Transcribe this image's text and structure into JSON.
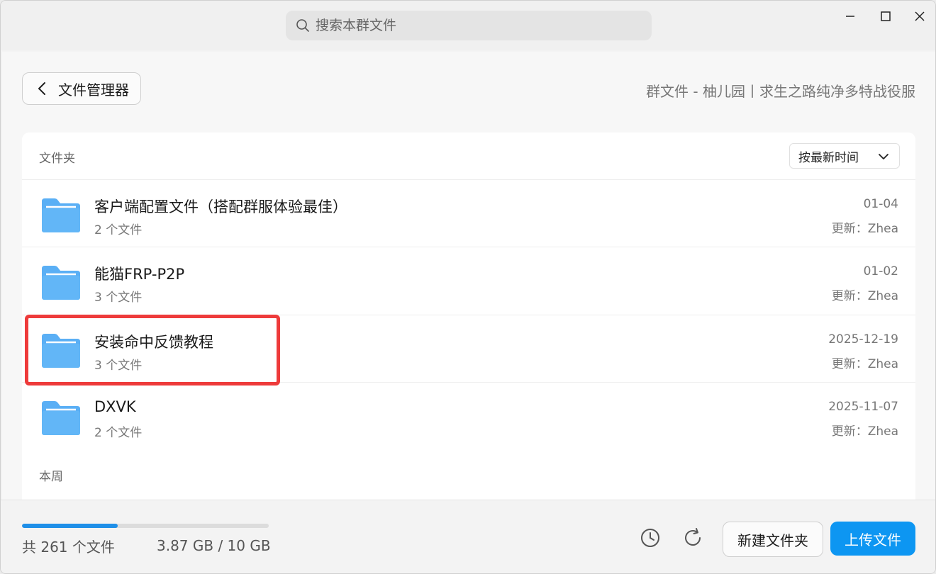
{
  "search": {
    "placeholder": "搜索本群文件"
  },
  "header": {
    "back_label": "文件管理器",
    "group_title": "群文件 - 柚儿园丨求生之路纯净多特战役服"
  },
  "folders_section": {
    "label": "文件夹",
    "sort_label": "按最新时间"
  },
  "folders": [
    {
      "name": "客户端配置文件（搭配群服体验最佳）",
      "count": "2 个文件",
      "date": "01-04",
      "updater": "更新：Zhea"
    },
    {
      "name": "能猫FRP-P2P",
      "count": "3 个文件",
      "date": "01-02",
      "updater": "更新：Zhea"
    },
    {
      "name": "安装命中反馈教程",
      "count": "3 个文件",
      "date": "2025-12-19",
      "updater": "更新：Zhea"
    },
    {
      "name": "DXVK",
      "count": "2 个文件",
      "date": "2025-11-07",
      "updater": "更新：Zhea"
    }
  ],
  "week_section": {
    "label": "本周"
  },
  "footer": {
    "file_total": "共 261 个文件",
    "storage": "3.87 GB / 10 GB",
    "storage_fraction": 0.387,
    "new_folder_label": "新建文件夹",
    "upload_label": "上传文件"
  },
  "colors": {
    "accent": "#0d96f2",
    "folder": "#5aaff5",
    "highlight": "#ee3b3b"
  },
  "icons": {
    "search": "search-icon",
    "minimize": "minimize-icon",
    "maximize": "maximize-icon",
    "close": "close-icon",
    "back": "chevron-left-icon",
    "sort": "chevron-down-icon",
    "folder": "folder-icon",
    "history": "clock-icon",
    "refresh": "refresh-icon"
  }
}
